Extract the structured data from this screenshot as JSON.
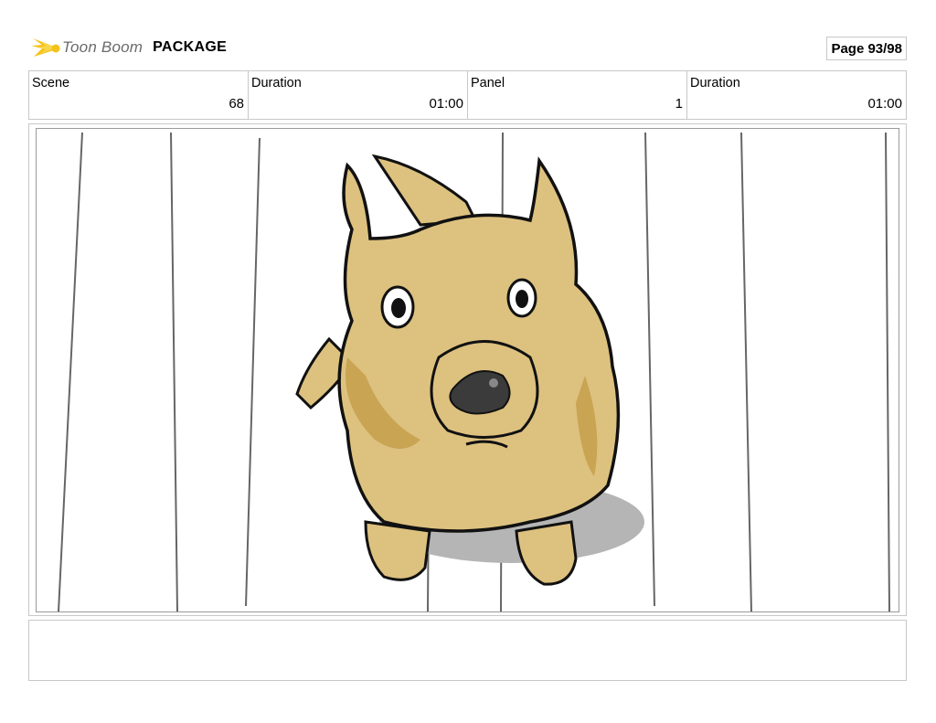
{
  "header": {
    "brand": "Toon Boom",
    "project": "PACKAGE",
    "page_label": "Page 93/98"
  },
  "info": [
    {
      "label": "Scene",
      "value": "68"
    },
    {
      "label": "Duration",
      "value": "01:00"
    },
    {
      "label": "Panel",
      "value": "1"
    },
    {
      "label": "Duration",
      "value": "01:00"
    }
  ],
  "panel": {
    "image_subject": "puppy-sketch",
    "fur_color": "#ddc17f",
    "fur_shade_color": "#c9a453",
    "shadow_color": "#b5b5b5",
    "nose_color": "#3b3b3b"
  },
  "caption": {
    "text": ""
  }
}
